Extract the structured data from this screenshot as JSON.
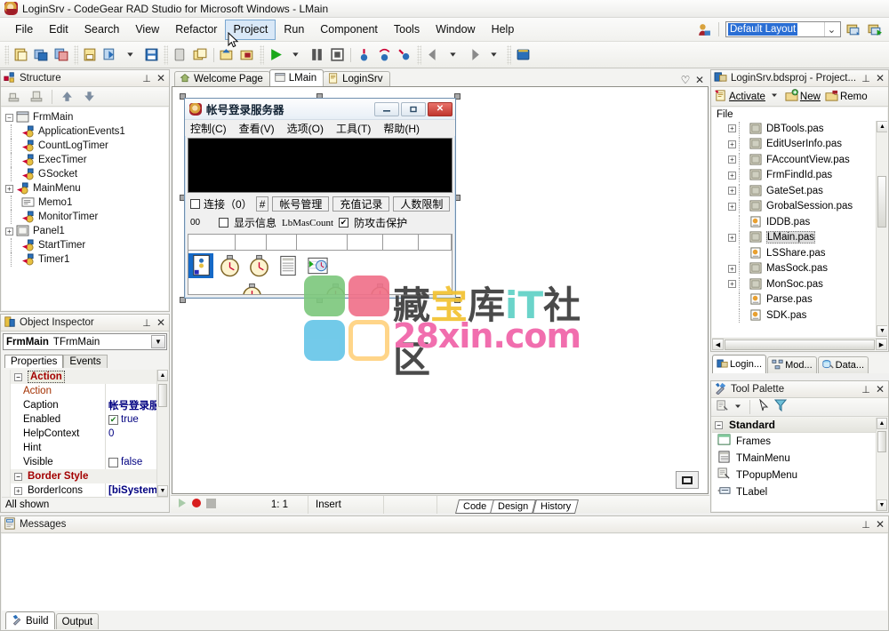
{
  "window": {
    "title": "LoginSrv - CodeGear RAD Studio for Microsoft Windows - LMain",
    "app_icon": "rad-studio-icon"
  },
  "menubar": {
    "items": [
      {
        "label": "File",
        "active": false
      },
      {
        "label": "Edit",
        "active": false
      },
      {
        "label": "Search",
        "active": false
      },
      {
        "label": "View",
        "active": false
      },
      {
        "label": "Refactor",
        "active": false
      },
      {
        "label": "Project",
        "active": true
      },
      {
        "label": "Run",
        "active": false
      },
      {
        "label": "Component",
        "active": false
      },
      {
        "label": "Tools",
        "active": false
      },
      {
        "label": "Window",
        "active": false
      },
      {
        "label": "Help",
        "active": false
      }
    ],
    "desktop_icon": "desktop-icon",
    "layout_combo": {
      "value": "Default Layout",
      "arrow": "chevron-down-icon"
    },
    "save_layout_icon": "save-desktop-icon",
    "set_debug_layout_icon": "debug-desktop-icon"
  },
  "toolbar": {
    "groups": [
      [
        "new-icon",
        "open-icon",
        "open-project-icon"
      ],
      [
        "save-icon",
        "save-as-icon",
        "save-all-icon",
        "close-icon",
        "close-all-icon",
        "add-to-project-icon",
        "remove-from-project-icon"
      ],
      [
        "run-icon",
        "run-dropdown-icon",
        "pause-icon",
        "stop-icon",
        "trace-into-icon",
        "step-over-icon",
        "run-to-cursor-icon"
      ],
      [
        "back-icon",
        "back-dropdown-icon",
        "forward-icon",
        "forward-dropdown-icon"
      ],
      [
        "help-icon"
      ]
    ]
  },
  "structure": {
    "title": "Structure",
    "icon": "structure-icon",
    "pin": "pin-icon",
    "close": "close-icon",
    "toolbar": [
      "collapse-all-icon",
      "expand-all-icon",
      "move-up-icon",
      "move-down-icon"
    ],
    "root": {
      "label": "FrmMain",
      "icon": "form-icon",
      "expander": "minus"
    },
    "nodes": [
      {
        "label": "ApplicationEvents1",
        "icon": "component-icon",
        "expander": "none"
      },
      {
        "label": "CountLogTimer",
        "icon": "component-icon",
        "expander": "none"
      },
      {
        "label": "ExecTimer",
        "icon": "component-icon",
        "expander": "none"
      },
      {
        "label": "GSocket",
        "icon": "component-icon",
        "expander": "none"
      },
      {
        "label": "MainMenu",
        "icon": "component-icon",
        "expander": "plus"
      },
      {
        "label": "Memo1",
        "icon": "memo-icon",
        "expander": "none"
      },
      {
        "label": "MonitorTimer",
        "icon": "component-icon",
        "expander": "none"
      },
      {
        "label": "Panel1",
        "icon": "panel-icon",
        "expander": "plus"
      },
      {
        "label": "StartTimer",
        "icon": "component-icon",
        "expander": "none"
      },
      {
        "label": "Timer1",
        "icon": "component-icon",
        "expander": "none"
      }
    ]
  },
  "inspector": {
    "title": "Object Inspector",
    "icon": "object-inspector-icon",
    "pin": "pin-icon",
    "close": "close-icon",
    "object_name": "FrmMain",
    "object_class": "TFrmMain",
    "dropdown": "chevron-down-icon",
    "tabs": [
      {
        "label": "Properties",
        "selected": true
      },
      {
        "label": "Events",
        "selected": false
      }
    ],
    "rows": [
      {
        "kind": "category",
        "name": "Action",
        "value": "",
        "selected": true,
        "expander": "minus"
      },
      {
        "kind": "prop",
        "name": "Action",
        "value": "",
        "name_color": "#a33000"
      },
      {
        "kind": "prop",
        "name": "Caption",
        "value": "帐号登录服",
        "value_bold": true,
        "value_color": "#000080"
      },
      {
        "kind": "prop-check",
        "name": "Enabled",
        "value": "true",
        "checked": true
      },
      {
        "kind": "prop",
        "name": "HelpContext",
        "value": "0",
        "value_color": "#000080"
      },
      {
        "kind": "prop",
        "name": "Hint",
        "value": ""
      },
      {
        "kind": "prop-check",
        "name": "Visible",
        "value": "false",
        "checked": false
      },
      {
        "kind": "category",
        "name": "Border Style",
        "value": "",
        "expander": "minus"
      },
      {
        "kind": "prop",
        "name": "BorderIcons",
        "value": "[biSystemM",
        "value_bold": true,
        "value_color": "#000080",
        "expander": "plus"
      }
    ],
    "status": "All shown",
    "scroll": {
      "up": "chevron-up-icon",
      "down": "chevron-down-icon"
    }
  },
  "editor": {
    "tabs": [
      {
        "label": "Welcome Page",
        "icon": "home-icon",
        "selected": false
      },
      {
        "label": "LMain",
        "icon": "form-icon",
        "selected": true
      },
      {
        "label": "LoginSrv",
        "icon": "project-icon",
        "selected": false
      }
    ],
    "pin": "pin-icon",
    "close": "close-icon",
    "status": {
      "run_icon": "run-arrow-icon",
      "record_icon": "record-icon",
      "stop_icon": "stop-icon",
      "caret": "1:  1",
      "mode": "Insert",
      "modified": ""
    },
    "view_tabs": [
      {
        "label": "Code",
        "selected": false
      },
      {
        "label": "Design",
        "selected": true
      },
      {
        "label": "History",
        "selected": false
      }
    ],
    "corner_button": "form-preview-button"
  },
  "design_form": {
    "title": "帐号登录服务器",
    "icon": "app-icon",
    "window_buttons": [
      {
        "name": "minimize-button",
        "glyph": "—"
      },
      {
        "name": "maximize-button",
        "glyph": "▫"
      },
      {
        "name": "close-button",
        "glyph": "✕"
      }
    ],
    "menu": [
      {
        "label": "控制(C)",
        "mnemonic": "C"
      },
      {
        "label": "查看(V)",
        "mnemonic": "V"
      },
      {
        "label": "选项(O)",
        "mnemonic": "O"
      },
      {
        "label": "工具(T)",
        "mnemonic": "T"
      },
      {
        "label": "帮助(H)",
        "mnemonic": "H"
      }
    ],
    "memo": {
      "name": "Memo1",
      "background": "#000000"
    },
    "panel_row1": {
      "checkbox_label": "连接（0）",
      "checkbox_checked": false,
      "hash": "#",
      "buttons": [
        "帐号管理",
        "充值记录",
        "人数限制"
      ]
    },
    "panel_row2": {
      "count": "00",
      "show_info_label": "显示信息",
      "show_info_checked": false,
      "lb_mas_count": "LbMasCount",
      "protect_label": "防攻击保护",
      "protect_checked": true
    },
    "nonvisual": [
      {
        "name": "ApplicationEvents1",
        "icon": "application-events-icon",
        "selected": true
      },
      {
        "name": "CountLogTimer",
        "icon": "timer-icon",
        "selected": false
      },
      {
        "name": "ExecTimer",
        "icon": "timer-icon",
        "selected": false
      },
      {
        "name": "MainMenu",
        "icon": "mainmenu-icon",
        "selected": false
      },
      {
        "name": "GSocket",
        "icon": "socket-icon",
        "selected": false
      }
    ],
    "nonvisual_row2": [
      {
        "name": "MonitorTimer",
        "icon": "timer-icon"
      },
      {
        "name": "StartTimer",
        "icon": "timer-icon"
      },
      {
        "name": "Timer1",
        "icon": "timer-icon"
      }
    ]
  },
  "watermark": {
    "line1": "藏宝库iT社区",
    "line2": "28xin.com",
    "squares": [
      "#7ec87e",
      "#f0718a",
      "#67c6e8",
      "#ffffff"
    ],
    "colors": {
      "zang": "#3b3b3b",
      "bao": "#f2c230",
      "ku": "#3b3b3b",
      "it": "#5fd1c6",
      "shequ": "#3b3b3b",
      "domain": "#f062a8"
    }
  },
  "project_manager": {
    "title": "LoginSrv.bdsproj - Project...",
    "icon": "project-manager-icon",
    "pin": "pin-icon",
    "close": "close-icon",
    "toolbar": [
      {
        "label": "Activate",
        "icon": "activate-icon",
        "dropdown": true
      },
      {
        "label": "New",
        "icon": "new-icon"
      },
      {
        "label": "Remo",
        "icon": "remove-icon"
      }
    ],
    "column_header": "File",
    "files": [
      {
        "label": "DBTools.pas",
        "icon": "unit-form-icon",
        "expander": "plus"
      },
      {
        "label": "EditUserInfo.pas",
        "icon": "unit-form-icon",
        "expander": "plus"
      },
      {
        "label": "FAccountView.pas",
        "icon": "unit-form-icon",
        "expander": "plus"
      },
      {
        "label": "FrmFindId.pas",
        "icon": "unit-form-icon",
        "expander": "plus"
      },
      {
        "label": "GateSet.pas",
        "icon": "unit-form-icon",
        "expander": "plus"
      },
      {
        "label": "GrobalSession.pas",
        "icon": "unit-form-icon",
        "expander": "plus"
      },
      {
        "label": "IDDB.pas",
        "icon": "unit-icon",
        "expander": "none"
      },
      {
        "label": "LMain.pas",
        "icon": "unit-form-icon",
        "expander": "plus",
        "selected": true
      },
      {
        "label": "LSShare.pas",
        "icon": "unit-icon",
        "expander": "none"
      },
      {
        "label": "MasSock.pas",
        "icon": "unit-form-icon",
        "expander": "plus"
      },
      {
        "label": "MonSoc.pas",
        "icon": "unit-form-icon",
        "expander": "plus"
      },
      {
        "label": "Parse.pas",
        "icon": "unit-icon",
        "expander": "none"
      },
      {
        "label": "SDK.pas",
        "icon": "unit-icon",
        "expander": "none"
      }
    ]
  },
  "right_tabs": [
    {
      "label": "Login...",
      "icon": "project-manager-icon",
      "selected": true
    },
    {
      "label": "Mod...",
      "icon": "model-view-icon",
      "selected": false
    },
    {
      "label": "Data...",
      "icon": "data-explorer-icon",
      "selected": false
    }
  ],
  "tool_palette": {
    "title": "Tool Palette",
    "icon": "tool-palette-icon",
    "pin": "pin-icon",
    "close": "close-icon",
    "toolbar": [
      "palette-properties-icon",
      "palette-dropdown-icon",
      "pointer-icon",
      "filter-icon"
    ],
    "category": {
      "label": "Standard",
      "expander": "minus"
    },
    "items": [
      {
        "label": "Frames",
        "icon": "frames-icon"
      },
      {
        "label": "TMainMenu",
        "icon": "mainmenu-icon"
      },
      {
        "label": "TPopupMenu",
        "icon": "popupmenu-icon"
      },
      {
        "label": "TLabel",
        "icon": "label-icon"
      }
    ],
    "scroll": {
      "up": "chevron-up-icon",
      "down": "chevron-down-icon"
    }
  },
  "messages": {
    "title": "Messages",
    "icon": "messages-icon",
    "pin": "pin-icon",
    "close": "close-icon",
    "content": "",
    "tabs": [
      {
        "label": "Build",
        "icon": "build-icon",
        "selected": true
      },
      {
        "label": "Output",
        "icon": "",
        "selected": false
      }
    ]
  }
}
